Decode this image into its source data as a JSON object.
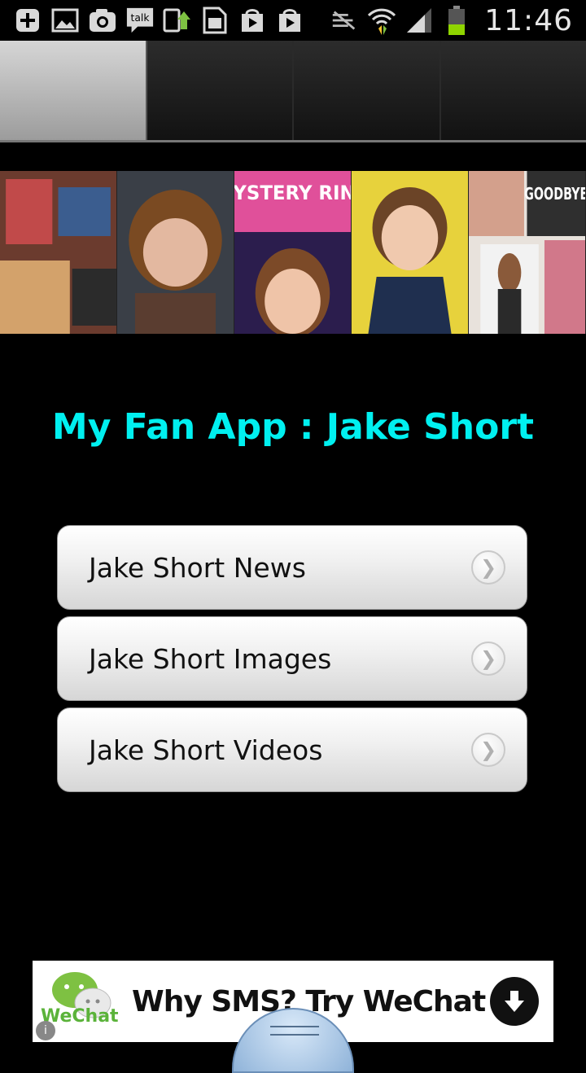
{
  "status_bar": {
    "time": "11:46",
    "icons": [
      "add-icon",
      "gallery-icon",
      "camera-icon",
      "talk-icon",
      "upload-icon",
      "sim-icon",
      "play-store-icon",
      "shopping-bag-icon",
      "no-sync-icon",
      "wifi-icon",
      "signal-icon",
      "battery-icon"
    ],
    "talk_label": "talk"
  },
  "tabs": [
    {
      "active": true
    },
    {
      "active": false
    },
    {
      "active": false
    },
    {
      "active": false
    }
  ],
  "banner": {
    "captions": [
      "MYSTERY RING",
      "GOODBYE"
    ]
  },
  "title": "My Fan App : Jake Short",
  "menu": [
    {
      "label": "Jake Short News",
      "icon": "chevron-right-icon"
    },
    {
      "label": "Jake Short Images",
      "icon": "chevron-right-icon"
    },
    {
      "label": "Jake Short Videos",
      "icon": "chevron-right-icon"
    }
  ],
  "ad": {
    "brand": "WeChat",
    "text": "Why SMS? Try WeChat",
    "info": "i"
  },
  "colors": {
    "title": "#00f0f0",
    "background": "#000000",
    "wechat_green": "#5bb33a"
  }
}
